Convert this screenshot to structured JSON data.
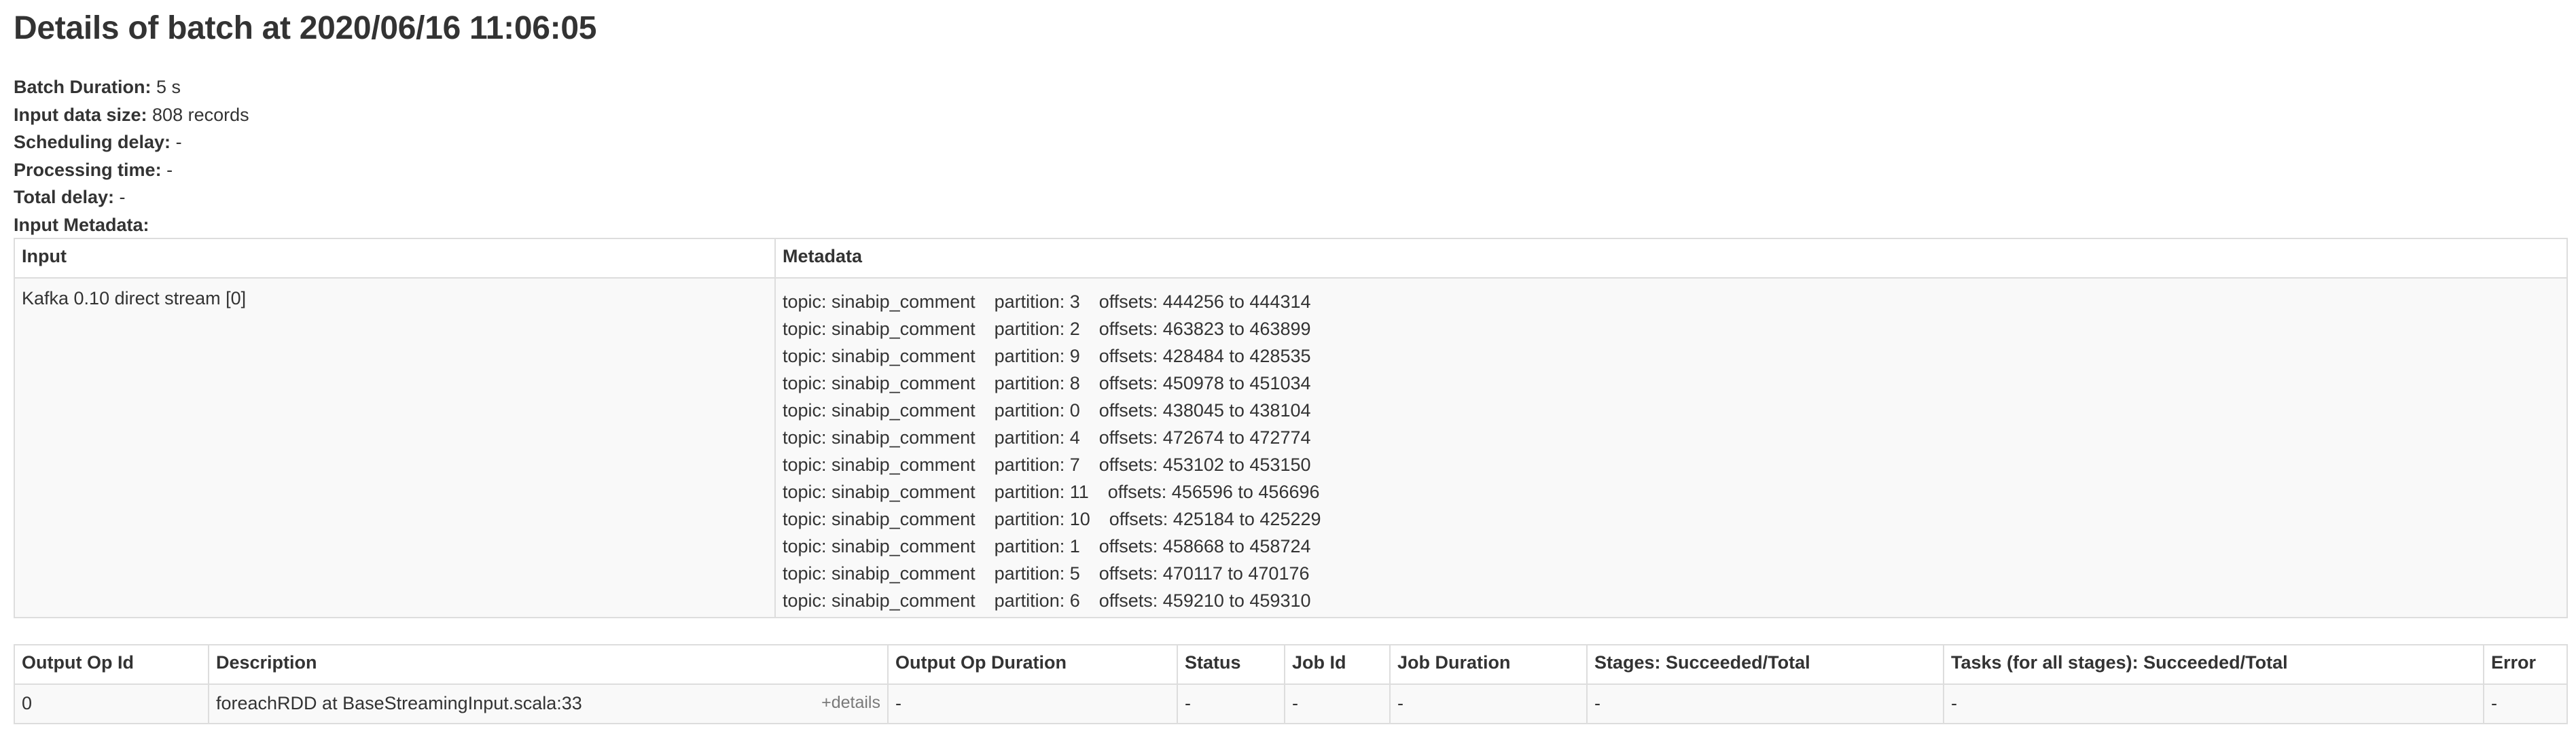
{
  "title": "Details of batch at 2020/06/16 11:06:05",
  "summary": [
    {
      "label": "Batch Duration:",
      "value": "5 s"
    },
    {
      "label": "Input data size:",
      "value": "808 records"
    },
    {
      "label": "Scheduling delay:",
      "value": "-"
    },
    {
      "label": "Processing time:",
      "value": "-"
    },
    {
      "label": "Total delay:",
      "value": "-"
    },
    {
      "label": "Input Metadata:",
      "value": ""
    }
  ],
  "metadata_table": {
    "headers": [
      "Input",
      "Metadata"
    ],
    "input": "Kafka 0.10 direct stream [0]",
    "rows": [
      {
        "topic": "topic: sinabip_comment",
        "partition": "partition: 3",
        "offsets": "offsets: 444256 to 444314"
      },
      {
        "topic": "topic: sinabip_comment",
        "partition": "partition: 2",
        "offsets": "offsets: 463823 to 463899"
      },
      {
        "topic": "topic: sinabip_comment",
        "partition": "partition: 9",
        "offsets": "offsets: 428484 to 428535"
      },
      {
        "topic": "topic: sinabip_comment",
        "partition": "partition: 8",
        "offsets": "offsets: 450978 to 451034"
      },
      {
        "topic": "topic: sinabip_comment",
        "partition": "partition: 0",
        "offsets": "offsets: 438045 to 438104"
      },
      {
        "topic": "topic: sinabip_comment",
        "partition": "partition: 4",
        "offsets": "offsets: 472674 to 472774"
      },
      {
        "topic": "topic: sinabip_comment",
        "partition": "partition: 7",
        "offsets": "offsets: 453102 to 453150"
      },
      {
        "topic": "topic: sinabip_comment",
        "partition": "partition: 11",
        "offsets": "offsets: 456596 to 456696"
      },
      {
        "topic": "topic: sinabip_comment",
        "partition": "partition: 10",
        "offsets": "offsets: 425184 to 425229"
      },
      {
        "topic": "topic: sinabip_comment",
        "partition": "partition: 1",
        "offsets": "offsets: 458668 to 458724"
      },
      {
        "topic": "topic: sinabip_comment",
        "partition": "partition: 5",
        "offsets": "offsets: 470117 to 470176"
      },
      {
        "topic": "topic: sinabip_comment",
        "partition": "partition: 6",
        "offsets": "offsets: 459210 to 459310"
      }
    ]
  },
  "ops_table": {
    "headers": [
      "Output Op Id",
      "Description",
      "Output Op Duration",
      "Status",
      "Job Id",
      "Job Duration",
      "Stages: Succeeded/Total",
      "Tasks (for all stages): Succeeded/Total",
      "Error"
    ],
    "rows": [
      {
        "op_id": "0",
        "description": "foreachRDD at BaseStreamingInput.scala:33",
        "details_link": "+details",
        "duration": "-",
        "status": "-",
        "job_id": "-",
        "job_duration": "-",
        "stages": "-",
        "tasks": "-",
        "error": "-"
      }
    ]
  }
}
